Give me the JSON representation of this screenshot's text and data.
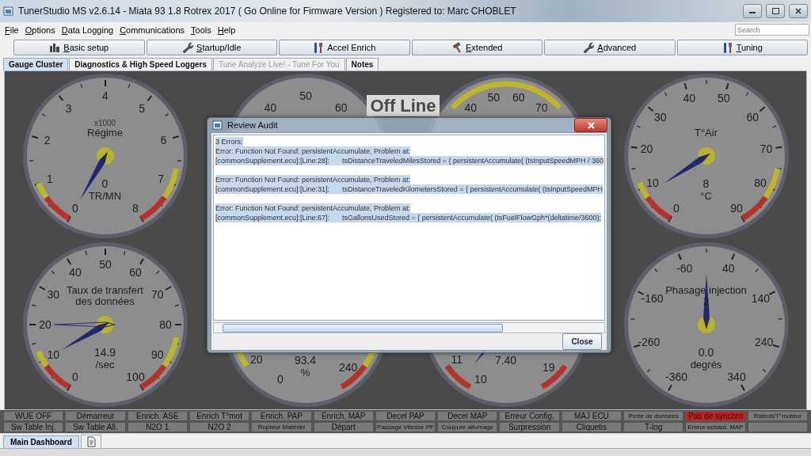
{
  "window": {
    "title": "TunerStudio MS v2.6.14 - Miata 93 1.8 Rotrex 2017 ( Go Online for Firmware Version ) Registered to: Marc CHOBLET"
  },
  "menu": [
    {
      "label": "File",
      "mnemonic": true
    },
    {
      "label": "Options",
      "mnemonic": true
    },
    {
      "label": "Data Logging",
      "mnemonic": true
    },
    {
      "label": "Communications",
      "mnemonic": true
    },
    {
      "label": "Tools",
      "mnemonic": true
    },
    {
      "label": "Help",
      "mnemonic": true
    }
  ],
  "search": {
    "placeholder": "Search"
  },
  "toolbar": [
    {
      "label": "Basic setup",
      "mnemonic": true
    },
    {
      "label": "Startup/Idle",
      "mnemonic": true
    },
    {
      "label": "Accel Enrich",
      "mnemonic": false
    },
    {
      "label": "Extended",
      "mnemonic": true
    },
    {
      "label": "Advanced",
      "mnemonic": true
    },
    {
      "label": "Tuning",
      "mnemonic": true
    }
  ],
  "tabs": [
    {
      "label": "Gauge Cluster",
      "selected": true,
      "disabled": false
    },
    {
      "label": "Diagnostics & High Speed Loggers",
      "selected": false,
      "disabled": false
    },
    {
      "label": "Tune Analyze Live! - Tune For You",
      "selected": false,
      "disabled": true
    },
    {
      "label": "Notes",
      "selected": false,
      "disabled": false
    }
  ],
  "gauges": [
    {
      "kind": "full",
      "multiplier": "x1000",
      "title": "Régime",
      "value": "0",
      "units": "TR/MN",
      "labels": [
        "0",
        "1",
        "2",
        "3",
        "4",
        "5",
        "6",
        "7",
        "8"
      ]
    },
    {
      "kind": "upper",
      "labels": [
        "40",
        "50",
        "60"
      ]
    },
    {
      "kind": "upper",
      "labels": [
        "40",
        "50",
        "60",
        "70"
      ]
    },
    {
      "kind": "full",
      "title": "T°Air",
      "value": "8",
      "units": "°C",
      "labels": [
        "0",
        "10",
        "20",
        "30",
        "40",
        "50",
        "60",
        "70",
        "80",
        "90"
      ]
    },
    {
      "kind": "full",
      "title": "Taux de transfert des données",
      "value": "14.9",
      "units": "/sec",
      "labels": [
        "0",
        "10",
        "20",
        "30",
        "40",
        "50",
        "60",
        "70",
        "80",
        "90",
        "100"
      ]
    },
    {
      "kind": "lower",
      "value": "93.4",
      "units": "%",
      "labels": [
        "20",
        "0",
        "240"
      ]
    },
    {
      "kind": "lower",
      "value": "7.40",
      "labels": [
        "11",
        "10",
        "19"
      ]
    },
    {
      "kind": "full",
      "title": "Phasage injection 2",
      "value": "0.0",
      "units": "degrés",
      "labels": [
        "-360",
        "-260",
        "-160",
        "-60",
        "40",
        "140",
        "240",
        "340"
      ]
    }
  ],
  "offline_badge": "Off Line",
  "dialog": {
    "title": "Review Audit",
    "text_selected": true,
    "header": "3 Errors:",
    "errors": [
      {
        "message": "Error: Function Not Found: persistentAccumulate, Problem at:",
        "line": "[commonSupplement.ecu]:[Line:28]:\ttsDistanceTraveledMilesStored = { persistentAccumulate( (tsInputSpeedMPH / 360"
      },
      {
        "message": "Error: Function Not Found: persistentAccumulate, Problem at:",
        "line": "[commonSupplement.ecu]:[Line:31]:\ttsDistanceTraveledKilometersStored = { persistentAccumulate( (tsInputSpeedMPH"
      },
      {
        "message": "Error: Function Not Found: persistentAccumulate, Problem at:",
        "line": "[commonSupplement.ecu]:[Line:67]:\ttsGallonsUsedStored = { persistentAccumulate( (tsFuelFlowGph*(deltatime/3600);"
      }
    ],
    "button": "Close"
  },
  "indicator_rows": [
    {
      "items": [
        {
          "label": "WUE OFF",
          "on": false
        },
        {
          "label": "Démarreur",
          "on": false
        },
        {
          "label": "Enrich. ASE",
          "on": false
        },
        {
          "label": "Enrich T°mot",
          "on": false
        },
        {
          "label": "Enrich. PAP",
          "on": false
        },
        {
          "label": "Enrich. MAP",
          "on": false
        },
        {
          "label": "Decel PAP",
          "on": false
        },
        {
          "label": "Decel MAP",
          "on": false
        },
        {
          "label": "Erreur Config.",
          "on": false
        },
        {
          "label": "MAJ ECU",
          "on": false
        },
        {
          "label": "Perte de données",
          "on": false
        },
        {
          "label": "Pas de synchro",
          "on": true
        },
        {
          "label": "Ralenti/T°moteur",
          "on": false
        }
      ]
    },
    {
      "items": [
        {
          "label": "Sw Table Inj.",
          "on": false
        },
        {
          "label": "Sw Table All.",
          "on": false
        },
        {
          "label": "N2O 1",
          "on": false
        },
        {
          "label": "N2O 2",
          "on": false
        },
        {
          "label": "Rupteur Matériel",
          "on": false
        },
        {
          "label": "Départ",
          "on": false
        },
        {
          "label": "Passage Vitesse PF",
          "on": false
        },
        {
          "label": "Coupure allumage",
          "on": false
        },
        {
          "label": "Surpression",
          "on": false
        },
        {
          "label": "Cliquetis",
          "on": false
        },
        {
          "label": "T-log",
          "on": false
        },
        {
          "label": "Erreur echant. MAP",
          "on": false
        },
        {
          "on": false
        }
      ]
    }
  ],
  "bottom_tabs": [
    {
      "label": "Main Dashboard",
      "selected": true
    }
  ]
}
